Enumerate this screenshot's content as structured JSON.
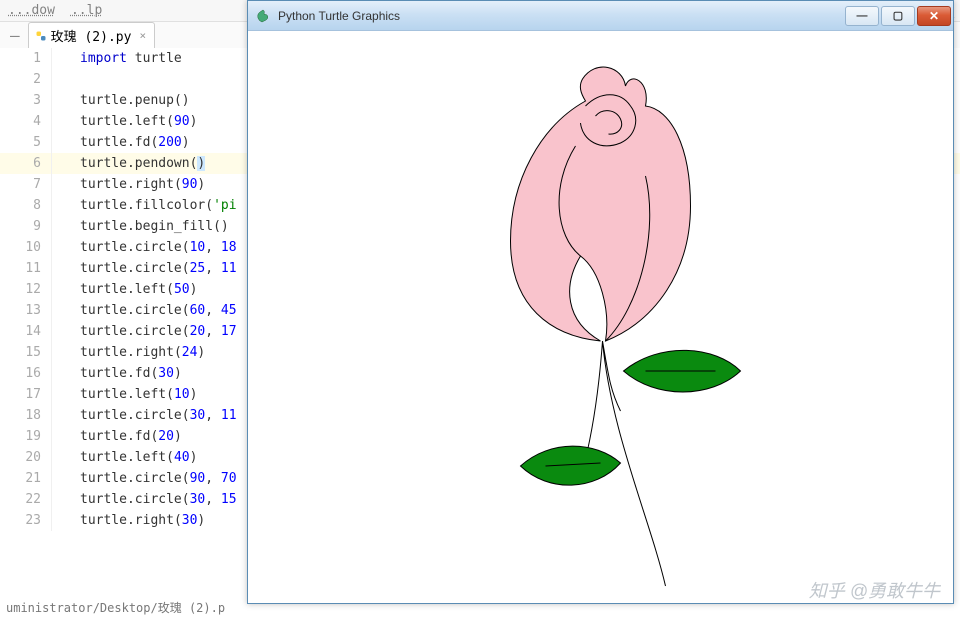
{
  "menu": {
    "item1": "...dow",
    "item2": "..lp"
  },
  "tab": {
    "name": "玫瑰 (2).py",
    "close": "×"
  },
  "turtle": {
    "title": "Python Turtle Graphics",
    "min": "—",
    "max": "▢",
    "close": "✕"
  },
  "code": {
    "lines": [
      {
        "n": 1,
        "tokens": [
          {
            "t": "import",
            "c": "kw"
          },
          {
            "t": " ",
            "c": ""
          },
          {
            "t": "turtle",
            "c": "ident"
          }
        ]
      },
      {
        "n": 2,
        "tokens": []
      },
      {
        "n": 3,
        "tokens": [
          {
            "t": "turtle",
            "c": "ident"
          },
          {
            "t": ".",
            "c": "punc"
          },
          {
            "t": "penup",
            "c": "ident"
          },
          {
            "t": "()",
            "c": "punc"
          }
        ]
      },
      {
        "n": 4,
        "tokens": [
          {
            "t": "turtle",
            "c": "ident"
          },
          {
            "t": ".",
            "c": "punc"
          },
          {
            "t": "left",
            "c": "ident"
          },
          {
            "t": "(",
            "c": "punc"
          },
          {
            "t": "90",
            "c": "num"
          },
          {
            "t": ")",
            "c": "punc"
          }
        ]
      },
      {
        "n": 5,
        "tokens": [
          {
            "t": "turtle",
            "c": "ident"
          },
          {
            "t": ".",
            "c": "punc"
          },
          {
            "t": "fd",
            "c": "ident"
          },
          {
            "t": "(",
            "c": "punc"
          },
          {
            "t": "200",
            "c": "num"
          },
          {
            "t": ")",
            "c": "punc"
          }
        ]
      },
      {
        "n": 6,
        "hl": true,
        "tokens": [
          {
            "t": "turtle",
            "c": "ident"
          },
          {
            "t": ".",
            "c": "punc"
          },
          {
            "t": "pendown",
            "c": "ident"
          },
          {
            "t": "(",
            "c": "punc"
          },
          {
            "t": ")",
            "c": "punc sel"
          }
        ]
      },
      {
        "n": 7,
        "tokens": [
          {
            "t": "turtle",
            "c": "ident"
          },
          {
            "t": ".",
            "c": "punc"
          },
          {
            "t": "right",
            "c": "ident"
          },
          {
            "t": "(",
            "c": "punc"
          },
          {
            "t": "90",
            "c": "num"
          },
          {
            "t": ")",
            "c": "punc"
          }
        ]
      },
      {
        "n": 8,
        "tokens": [
          {
            "t": "turtle",
            "c": "ident"
          },
          {
            "t": ".",
            "c": "punc"
          },
          {
            "t": "fillcolor",
            "c": "ident"
          },
          {
            "t": "(",
            "c": "punc"
          },
          {
            "t": "'pi",
            "c": "str"
          }
        ]
      },
      {
        "n": 9,
        "tokens": [
          {
            "t": "turtle",
            "c": "ident"
          },
          {
            "t": ".",
            "c": "punc"
          },
          {
            "t": "begin_fill",
            "c": "ident"
          },
          {
            "t": "()",
            "c": "punc"
          }
        ]
      },
      {
        "n": 10,
        "tokens": [
          {
            "t": "turtle",
            "c": "ident"
          },
          {
            "t": ".",
            "c": "punc"
          },
          {
            "t": "circle",
            "c": "ident"
          },
          {
            "t": "(",
            "c": "punc"
          },
          {
            "t": "10",
            "c": "num"
          },
          {
            "t": ", ",
            "c": "punc"
          },
          {
            "t": "18",
            "c": "num"
          }
        ]
      },
      {
        "n": 11,
        "tokens": [
          {
            "t": "turtle",
            "c": "ident"
          },
          {
            "t": ".",
            "c": "punc"
          },
          {
            "t": "circle",
            "c": "ident"
          },
          {
            "t": "(",
            "c": "punc"
          },
          {
            "t": "25",
            "c": "num"
          },
          {
            "t": ", ",
            "c": "punc"
          },
          {
            "t": "11",
            "c": "num"
          }
        ]
      },
      {
        "n": 12,
        "tokens": [
          {
            "t": "turtle",
            "c": "ident"
          },
          {
            "t": ".",
            "c": "punc"
          },
          {
            "t": "left",
            "c": "ident"
          },
          {
            "t": "(",
            "c": "punc"
          },
          {
            "t": "50",
            "c": "num"
          },
          {
            "t": ")",
            "c": "punc"
          }
        ]
      },
      {
        "n": 13,
        "tokens": [
          {
            "t": "turtle",
            "c": "ident"
          },
          {
            "t": ".",
            "c": "punc"
          },
          {
            "t": "circle",
            "c": "ident"
          },
          {
            "t": "(",
            "c": "punc"
          },
          {
            "t": "60",
            "c": "num"
          },
          {
            "t": ", ",
            "c": "punc"
          },
          {
            "t": "45",
            "c": "num"
          }
        ]
      },
      {
        "n": 14,
        "tokens": [
          {
            "t": "turtle",
            "c": "ident"
          },
          {
            "t": ".",
            "c": "punc"
          },
          {
            "t": "circle",
            "c": "ident"
          },
          {
            "t": "(",
            "c": "punc"
          },
          {
            "t": "20",
            "c": "num"
          },
          {
            "t": ", ",
            "c": "punc"
          },
          {
            "t": "17",
            "c": "num"
          }
        ]
      },
      {
        "n": 15,
        "tokens": [
          {
            "t": "turtle",
            "c": "ident"
          },
          {
            "t": ".",
            "c": "punc"
          },
          {
            "t": "right",
            "c": "ident"
          },
          {
            "t": "(",
            "c": "punc"
          },
          {
            "t": "24",
            "c": "num"
          },
          {
            "t": ")",
            "c": "punc"
          }
        ]
      },
      {
        "n": 16,
        "tokens": [
          {
            "t": "turtle",
            "c": "ident"
          },
          {
            "t": ".",
            "c": "punc"
          },
          {
            "t": "fd",
            "c": "ident"
          },
          {
            "t": "(",
            "c": "punc"
          },
          {
            "t": "30",
            "c": "num"
          },
          {
            "t": ")",
            "c": "punc"
          }
        ]
      },
      {
        "n": 17,
        "tokens": [
          {
            "t": "turtle",
            "c": "ident"
          },
          {
            "t": ".",
            "c": "punc"
          },
          {
            "t": "left",
            "c": "ident"
          },
          {
            "t": "(",
            "c": "punc"
          },
          {
            "t": "10",
            "c": "num"
          },
          {
            "t": ")",
            "c": "punc"
          }
        ]
      },
      {
        "n": 18,
        "tokens": [
          {
            "t": "turtle",
            "c": "ident"
          },
          {
            "t": ".",
            "c": "punc"
          },
          {
            "t": "circle",
            "c": "ident"
          },
          {
            "t": "(",
            "c": "punc"
          },
          {
            "t": "30",
            "c": "num"
          },
          {
            "t": ", ",
            "c": "punc"
          },
          {
            "t": "11",
            "c": "num"
          }
        ]
      },
      {
        "n": 19,
        "tokens": [
          {
            "t": "turtle",
            "c": "ident"
          },
          {
            "t": ".",
            "c": "punc"
          },
          {
            "t": "fd",
            "c": "ident"
          },
          {
            "t": "(",
            "c": "punc"
          },
          {
            "t": "20",
            "c": "num"
          },
          {
            "t": ")",
            "c": "punc"
          }
        ]
      },
      {
        "n": 20,
        "tokens": [
          {
            "t": "turtle",
            "c": "ident"
          },
          {
            "t": ".",
            "c": "punc"
          },
          {
            "t": "left",
            "c": "ident"
          },
          {
            "t": "(",
            "c": "punc"
          },
          {
            "t": "40",
            "c": "num"
          },
          {
            "t": ")",
            "c": "punc"
          }
        ]
      },
      {
        "n": 21,
        "tokens": [
          {
            "t": "turtle",
            "c": "ident"
          },
          {
            "t": ".",
            "c": "punc"
          },
          {
            "t": "circle",
            "c": "ident"
          },
          {
            "t": "(",
            "c": "punc"
          },
          {
            "t": "90",
            "c": "num"
          },
          {
            "t": ", ",
            "c": "punc"
          },
          {
            "t": "70",
            "c": "num"
          }
        ]
      },
      {
        "n": 22,
        "tokens": [
          {
            "t": "turtle",
            "c": "ident"
          },
          {
            "t": ".",
            "c": "punc"
          },
          {
            "t": "circle",
            "c": "ident"
          },
          {
            "t": "(",
            "c": "punc"
          },
          {
            "t": "30",
            "c": "num"
          },
          {
            "t": ", ",
            "c": "punc"
          },
          {
            "t": "15",
            "c": "num"
          }
        ]
      },
      {
        "n": 23,
        "tokens": [
          {
            "t": "turtle",
            "c": "ident"
          },
          {
            "t": ".",
            "c": "punc"
          },
          {
            "t": "right",
            "c": "ident"
          },
          {
            "t": "(",
            "c": "punc"
          },
          {
            "t": "30",
            "c": "num"
          },
          {
            "t": ")",
            "c": "punc"
          }
        ]
      }
    ]
  },
  "status": "uministrator/Desktop/玫瑰  (2).p",
  "watermark": "知乎 @勇敢牛牛"
}
